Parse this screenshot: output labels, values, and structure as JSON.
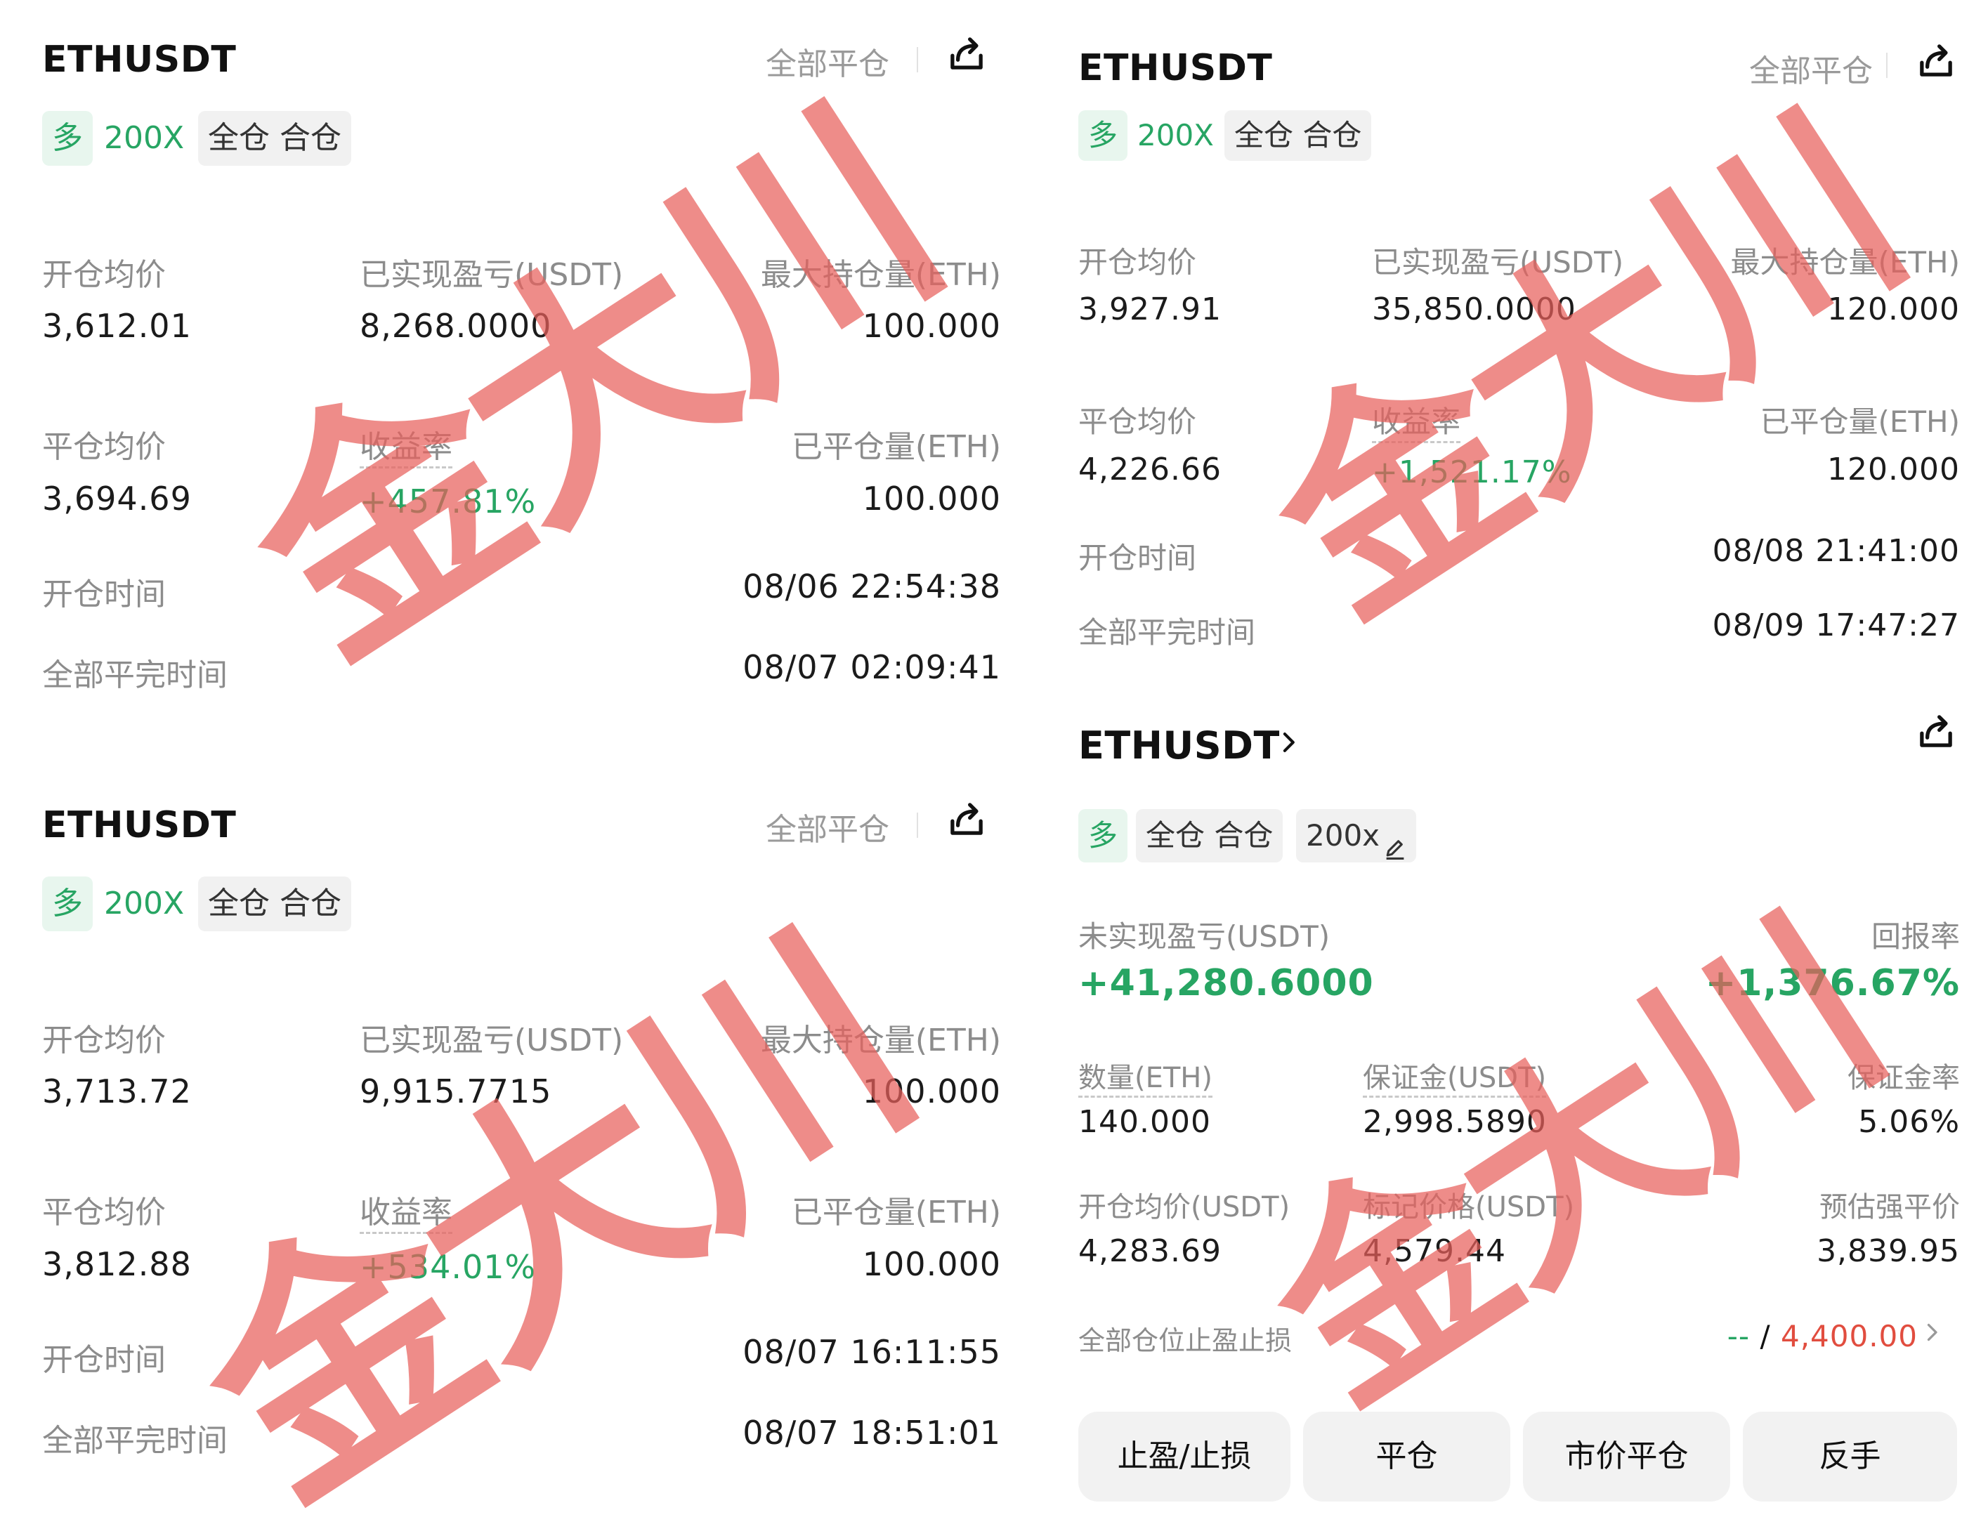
{
  "cards": [
    {
      "symbol": "ETHUSDT",
      "close_all": "全部平仓",
      "tag_long": "多",
      "leverage": "200X",
      "margin_mode": "全仓 合仓",
      "labels": {
        "open_avg": "开仓均价",
        "realized_pnl": "已实现盈亏(USDT)",
        "max_position": "最大持仓量(ETH)",
        "close_avg": "平仓均价",
        "roi": "收益率",
        "closed_qty": "已平仓量(ETH)",
        "open_time": "开仓时间",
        "close_time": "全部平完时间"
      },
      "values": {
        "open_avg": "3,612.01",
        "realized_pnl": "8,268.0000",
        "max_position": "100.000",
        "close_avg": "3,694.69",
        "roi": "+457.81%",
        "closed_qty": "100.000",
        "open_time": "08/06 22:54:38",
        "close_time": "08/07 02:09:41"
      }
    },
    {
      "symbol": "ETHUSDT",
      "close_all": "全部平仓",
      "tag_long": "多",
      "leverage": "200X",
      "margin_mode": "全仓 合仓",
      "labels": {
        "open_avg": "开仓均价",
        "realized_pnl": "已实现盈亏(USDT)",
        "max_position": "最大持仓量(ETH)",
        "close_avg": "平仓均价",
        "roi": "收益率",
        "closed_qty": "已平仓量(ETH)",
        "open_time": "开仓时间",
        "close_time": "全部平完时间"
      },
      "values": {
        "open_avg": "3,713.72",
        "realized_pnl": "9,915.7715",
        "max_position": "100.000",
        "close_avg": "3,812.88",
        "roi": "+534.01%",
        "closed_qty": "100.000",
        "open_time": "08/07 16:11:55",
        "close_time": "08/07 18:51:01"
      }
    },
    {
      "symbol": "ETHUSDT",
      "close_all": "全部平仓",
      "tag_long": "多",
      "leverage": "200X",
      "margin_mode": "全仓 合仓",
      "labels": {
        "open_avg": "开仓均价",
        "realized_pnl": "已实现盈亏(USDT)",
        "max_position": "最大持仓量(ETH)",
        "close_avg": "平仓均价",
        "roi": "收益率",
        "closed_qty": "已平仓量(ETH)",
        "open_time": "开仓时间",
        "close_time": "全部平完时间"
      },
      "values": {
        "open_avg": "3,927.91",
        "realized_pnl": "35,850.0000",
        "max_position": "120.000",
        "close_avg": "4,226.66",
        "roi": "+1,521.17%",
        "closed_qty": "120.000",
        "open_time": "08/08 21:41:00",
        "close_time": "08/09 17:47:27"
      }
    }
  ],
  "position": {
    "symbol": "ETHUSDT",
    "tag_long": "多",
    "margin_mode": "全仓 合仓",
    "leverage": "200x",
    "labels": {
      "unrealized_pnl": "未实现盈亏(USDT)",
      "roe": "回报率",
      "qty": "数量(ETH)",
      "margin": "保证金(USDT)",
      "margin_ratio": "保证金率",
      "open_avg": "开仓均价(USDT)",
      "mark_price": "标记价格(USDT)",
      "liq_price": "预估强平价",
      "tpsl": "全部仓位止盈止损"
    },
    "values": {
      "unrealized_pnl": "+41,280.6000",
      "roe": "+1,376.67%",
      "qty": "140.000",
      "margin": "2,998.5890",
      "margin_ratio": "5.06%",
      "open_avg": "4,283.69",
      "mark_price": "4,579.44",
      "liq_price": "3,839.95",
      "tp": "--",
      "tpsl_sep": "/",
      "sl": "4,400.00"
    },
    "buttons": {
      "tpsl": "止盈/止损",
      "close": "平仓",
      "market_close": "市价平仓",
      "reverse": "反手"
    }
  },
  "watermark": "金大川",
  "colors": {
    "green": "#27a563",
    "red": "#e14d3f",
    "watermark": "#e8605c"
  },
  "icons": {
    "share": "share-icon",
    "chevron": "chevron-right-icon",
    "edit": "edit-pencil-icon"
  }
}
